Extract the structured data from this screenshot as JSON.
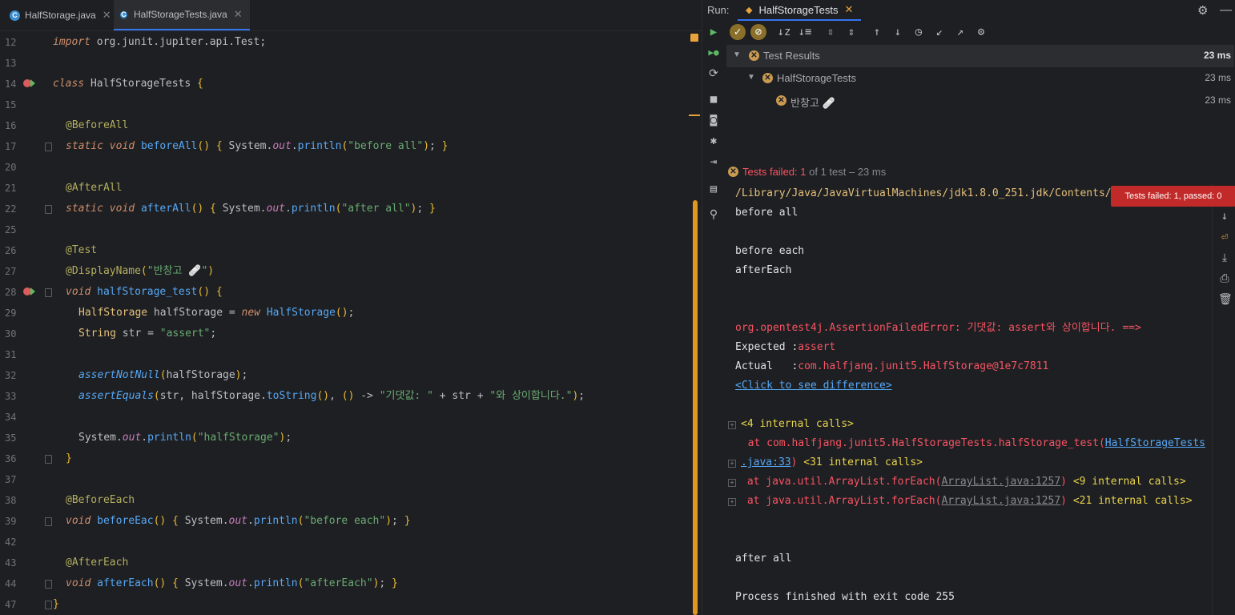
{
  "editor": {
    "tabs": [
      {
        "label": "HalfStorage.java",
        "active": false
      },
      {
        "label": "HalfStorageTests.java",
        "active": true
      }
    ],
    "lines": [
      {
        "n": "12",
        "code": "import org.junit.jupiter.api.Test;"
      },
      {
        "n": "13",
        "code": ""
      },
      {
        "n": "14",
        "code": "class HalfStorageTests {"
      },
      {
        "n": "15",
        "code": ""
      },
      {
        "n": "16",
        "code": "@BeforeAll"
      },
      {
        "n": "17",
        "code": "static void beforeAll() { System.out.println(\"before all\"); }"
      },
      {
        "n": "20",
        "code": ""
      },
      {
        "n": "21",
        "code": "@AfterAll"
      },
      {
        "n": "22",
        "code": "static void afterAll() { System.out.println(\"after all\"); }"
      },
      {
        "n": "25",
        "code": ""
      },
      {
        "n": "26",
        "code": "@Test"
      },
      {
        "n": "27",
        "code": "@DisplayName(\"반창고 🩹\")"
      },
      {
        "n": "28",
        "code": "void halfStorage_test() {"
      },
      {
        "n": "29",
        "code": "HalfStorage halfStorage = new HalfStorage();"
      },
      {
        "n": "30",
        "code": "String str = \"assert\";"
      },
      {
        "n": "31",
        "code": ""
      },
      {
        "n": "32",
        "code": "assertNotNull(halfStorage);"
      },
      {
        "n": "33",
        "code": "assertEquals(str, halfStorage.toString(), () -> \"기댓값: \" + str + \"와 상이합니다.\");"
      },
      {
        "n": "34",
        "code": ""
      },
      {
        "n": "35",
        "code": "System.out.println(\"halfStorage\");"
      },
      {
        "n": "36",
        "code": "}"
      },
      {
        "n": "37",
        "code": ""
      },
      {
        "n": "38",
        "code": "@BeforeEach"
      },
      {
        "n": "39",
        "code": "void beforeEac() { System.out.println(\"before each\"); }"
      },
      {
        "n": "42",
        "code": ""
      },
      {
        "n": "43",
        "code": "@AfterEach"
      },
      {
        "n": "44",
        "code": "void afterEach() { System.out.println(\"afterEach\"); }"
      },
      {
        "n": "47",
        "code": "}"
      }
    ]
  },
  "run": {
    "label": "Run:",
    "tab": "HalfStorageTests",
    "tree": [
      {
        "label": "Test Results",
        "time": "23 ms"
      },
      {
        "label": "HalfStorageTests",
        "time": "23 ms"
      },
      {
        "label": "반창고 🩹",
        "time": "23 ms"
      }
    ],
    "status": {
      "prefix": "Tests failed: ",
      "count": "1",
      "suffix": " of 1 test – 23 ms"
    },
    "badge": "Tests failed: 1, passed: 0",
    "console": {
      "path": "/Library/Java/JavaVirtualMachines/jdk1.8.0_251.jdk/Contents/Home/bi",
      "before_all": "before all",
      "before_each": "before each",
      "after_each": "afterEach",
      "error": "org.opentest4j.AssertionFailedError: 기댓값: assert와 상이합니다. ==>",
      "expected_label": "Expected :",
      "expected_value": "assert",
      "actual_label": "Actual   :",
      "actual_value": "com.halfjang.junit5.HalfStorage@1e7c7811",
      "diff_link": "<Click to see difference>",
      "internal1": "<4 internal calls>",
      "at1_prefix": "  at com.halfjang.junit5.HalfStorageTests.halfStorage_test(",
      "at1_link": "HalfStorageTests",
      "at1_link2": ".java:33",
      "at1_suffix": ")",
      "internal2": " <31 internal calls>",
      "at2_prefix": " at java.util.ArrayList.forEach(",
      "at2_link": "ArrayList.java:1257",
      "at2_suffix": ")",
      "internal3": " <9 internal calls>",
      "at3_prefix": " at java.util.ArrayList.forEach(",
      "at3_link": "ArrayList.java:1257",
      "at3_suffix": ")",
      "internal4": " <21 internal calls>",
      "after_all": "after all",
      "exit": "Process finished with exit code 255"
    }
  }
}
